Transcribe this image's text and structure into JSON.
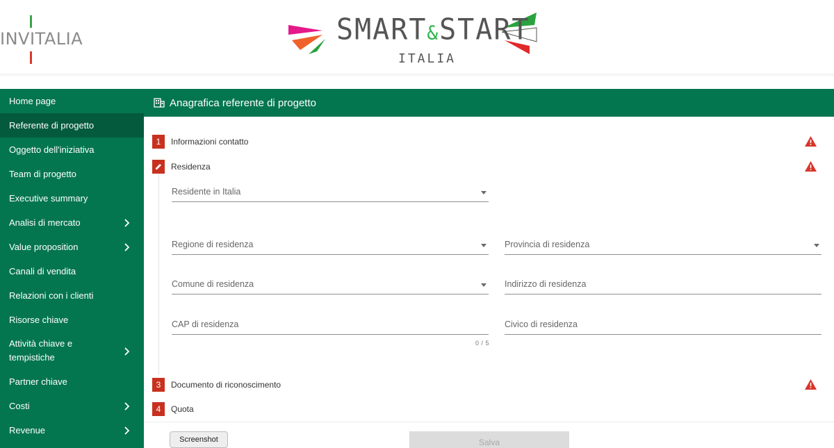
{
  "header": {
    "invitalia_logo_text": "INVITALIA",
    "smartstart_logo": {
      "part1": "SMART",
      "amp": "&",
      "part2": "START",
      "subtitle": "ITALIA"
    }
  },
  "sidebar": {
    "items": [
      {
        "label": "Home page",
        "has_submenu": false
      },
      {
        "label": "Referente di progetto",
        "has_submenu": false,
        "active": true
      },
      {
        "label": "Oggetto dell'iniziativa",
        "has_submenu": false
      },
      {
        "label": "Team di progetto",
        "has_submenu": false
      },
      {
        "label": "Executive summary",
        "has_submenu": false
      },
      {
        "label": "Analisi di mercato",
        "has_submenu": true
      },
      {
        "label": "Value proposition",
        "has_submenu": true
      },
      {
        "label": "Canali di vendita",
        "has_submenu": false
      },
      {
        "label": "Relazioni con i clienti",
        "has_submenu": false
      },
      {
        "label": "Risorse chiave",
        "has_submenu": false
      },
      {
        "label": "Attività chiave e tempistiche",
        "has_submenu": true
      },
      {
        "label": "Partner chiave",
        "has_submenu": false
      },
      {
        "label": "Costi",
        "has_submenu": true
      },
      {
        "label": "Revenue",
        "has_submenu": true
      }
    ]
  },
  "panel": {
    "title": "Anagrafica referente di progetto",
    "title_icon": "building-icon"
  },
  "steps": [
    {
      "number": "1",
      "label": "Informazioni contatto",
      "warning": true
    },
    {
      "number": "edit",
      "label": "Residenza",
      "warning": true
    },
    {
      "number": "3",
      "label": "Documento di riconoscimento",
      "warning": true
    },
    {
      "number": "4",
      "label": "Quota",
      "warning": false
    }
  ],
  "form": {
    "residente_in_italia": {
      "placeholder": "Residente in Italia",
      "type": "select"
    },
    "regione": {
      "placeholder": "Regione di residenza",
      "type": "select"
    },
    "provincia": {
      "placeholder": "Provincia di residenza",
      "type": "select"
    },
    "comune": {
      "placeholder": "Comune di residenza",
      "type": "select"
    },
    "indirizzo": {
      "placeholder": "Indirizzo di residenza",
      "type": "text"
    },
    "cap": {
      "placeholder": "CAP di residenza",
      "type": "text",
      "counter": "0 / 5"
    },
    "civico": {
      "placeholder": "Civico di residenza",
      "type": "text"
    }
  },
  "buttons": {
    "screenshot": "Screenshot",
    "save": "Salva"
  },
  "colors": {
    "brand_green": "#04764f",
    "active_green": "#035a3c",
    "step_red": "#c8311f",
    "warning_red": "#d9352a"
  }
}
